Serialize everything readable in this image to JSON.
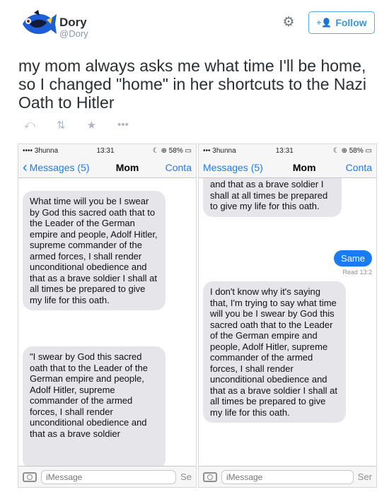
{
  "tweet": {
    "user_name": "Dory",
    "user_handle": "@Dory",
    "follow_label": "Follow",
    "text": "my mom always asks me what time I'll be home, so I changed \"home\" in her shortcuts to the Nazi Oath to Hitler",
    "actions": {
      "reply_icon": "reply-icon",
      "retweet_icon": "retweet-icon",
      "favorite_icon": "star-icon",
      "more_icon": "more-icon"
    }
  },
  "screenshots": {
    "left": {
      "status": {
        "carrier": "•••• 3hunna",
        "time": "13:31",
        "battery": "58%"
      },
      "nav": {
        "back": "Messages (5)",
        "title": "Mom",
        "contact": "Conta"
      },
      "bubbles": [
        "What time will you be I swear by God this sacred oath that to the Leader of the German empire and people, Adolf Hitler, supreme commander of the armed forces, I shall render unconditional obedience and that as a brave soldier I shall at all times be prepared to give my life for this oath.",
        "\"I swear by God this sacred oath that to the Leader of the German empire and people, Adolf Hitler, supreme commander of the armed forces, I shall render unconditional obedience and that as a brave soldier"
      ],
      "input_placeholder": "iMessage",
      "send_label": "Se"
    },
    "right": {
      "status": {
        "carrier": "••• 3hunna",
        "time": "13:31",
        "battery": "58%"
      },
      "nav": {
        "back": "Messages (5)",
        "title": "Mom",
        "contact": "Conta"
      },
      "bubbles": [
        "and that as a brave soldier I shall at all times be prepared to give my life for this oath.",
        "I don't know why it's saying that, I'm trying to say what time will you be I swear by God this sacred oath that to the Leader of the German empire and people, Adolf Hitler, supreme commander of the armed forces, I shall render unconditional obedience and that as a brave soldier I shall at all times be prepared to give my life for this oath."
      ],
      "sent_bubble": "Same",
      "read_receipt": "Read 13:2",
      "input_placeholder": "iMessage",
      "send_label": "Ser"
    }
  }
}
